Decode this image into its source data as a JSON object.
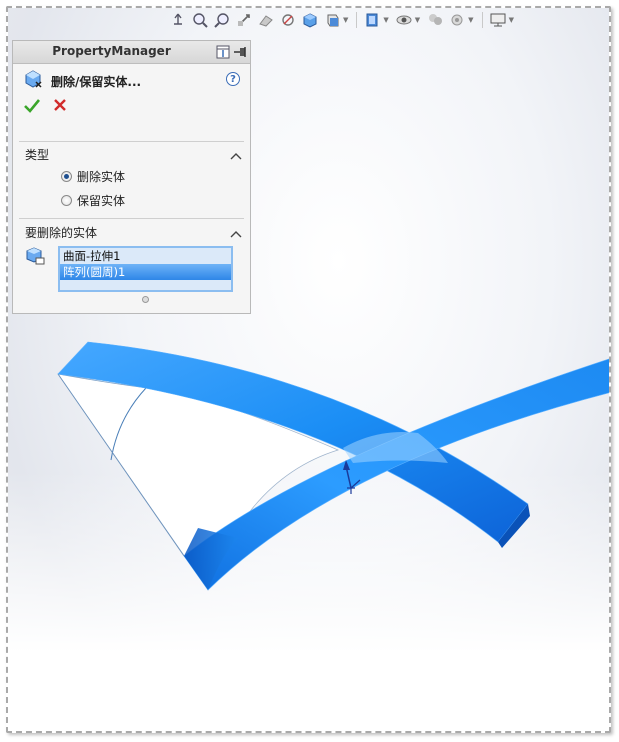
{
  "property_manager": {
    "title": "PropertyManager",
    "feature_title": "删除/保留实体...",
    "help_label": "?",
    "type_section": {
      "label": "类型",
      "options": [
        {
          "label": "删除实体",
          "checked": true
        },
        {
          "label": "保留实体",
          "checked": false
        }
      ]
    },
    "bodies_section": {
      "label": "要删除的实体",
      "items": [
        {
          "label": "曲面-拉伸1",
          "selected": false
        },
        {
          "label": "阵列(圆周)1",
          "selected": true
        }
      ]
    }
  },
  "hud_toolbar": {
    "icons": [
      "view-orientation-icon",
      "zoom-to-fit-icon",
      "zoom-to-area-icon",
      "previous-view-icon",
      "section-view-icon",
      "dynamic-annotation-icon",
      "view-orientation-cube-icon",
      "display-style-icon",
      "hide-show-items-icon",
      "edit-appearance-icon",
      "apply-scene-icon",
      "view-settings-icon"
    ]
  },
  "colors": {
    "body_blue": "#1e90f5",
    "body_dark_blue": "#0b5fd0",
    "selection_blue": "#3b8ff0",
    "accent_check": "#3aa52a",
    "accent_cancel": "#d12b2b"
  }
}
